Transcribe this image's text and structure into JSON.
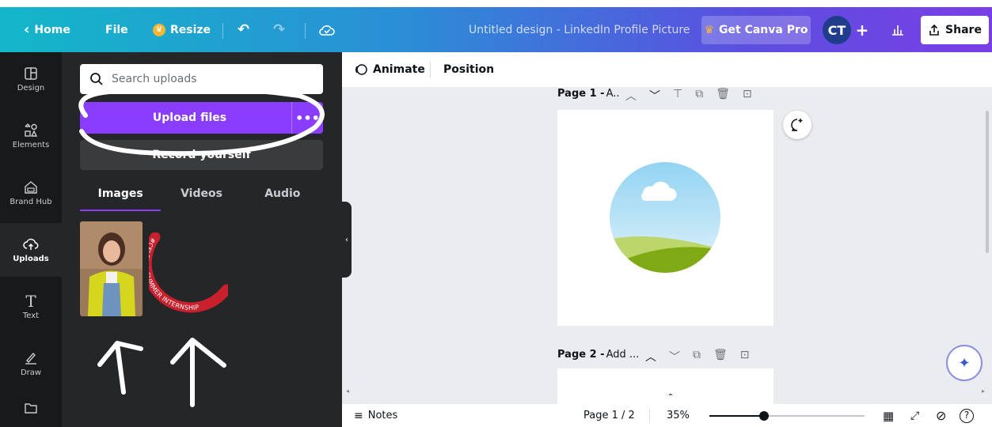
{
  "topbar": {
    "home": "Home",
    "file": "File",
    "resize": "Resize",
    "title": "Untitled design - LinkedIn Profile Picture",
    "get_pro": "Get Canva Pro",
    "avatar_initials": "CT",
    "plus": "+",
    "share": "Share"
  },
  "rail": {
    "items": [
      {
        "label": "Design",
        "icon": "design-icon"
      },
      {
        "label": "Elements",
        "icon": "elements-icon"
      },
      {
        "label": "Brand Hub",
        "icon": "brand-hub-icon"
      },
      {
        "label": "Uploads",
        "icon": "uploads-icon"
      },
      {
        "label": "Text",
        "icon": "text-icon"
      },
      {
        "label": "Draw",
        "icon": "draw-icon"
      },
      {
        "label": "",
        "icon": "projects-icon"
      }
    ],
    "active": "Uploads"
  },
  "panel": {
    "search_placeholder": "Search uploads",
    "upload_button": "Upload files",
    "record_button": "Record yourself",
    "tabs": [
      "Images",
      "Videos",
      "Audio"
    ],
    "active_tab": "Images",
    "frame_text": "#CELEBAL SUMMER INTERNSHIP"
  },
  "toolbar": {
    "animate": "Animate",
    "position": "Position"
  },
  "pages": {
    "page1_label": "Page 1 -",
    "page1_title": "A..",
    "page2_label": "Page 2 -",
    "page2_title": "Add ..."
  },
  "footer": {
    "notes": "Notes",
    "page_indicator": "Page 1 / 2",
    "zoom": "35%",
    "zoom_level": 0.35
  },
  "colors": {
    "accent": "#8b3dff",
    "topbar_start": "#13b7c9",
    "topbar_end": "#7a3fe4",
    "frame_red": "#c8202c"
  }
}
